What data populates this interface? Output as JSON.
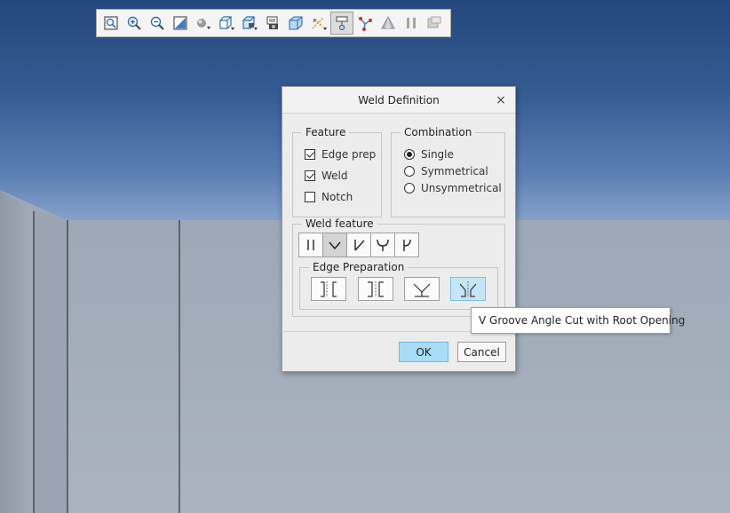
{
  "toolbar": {
    "buttons": [
      {
        "icon": "refit-icon"
      },
      {
        "icon": "zoom-in-icon"
      },
      {
        "icon": "zoom-out-icon"
      },
      {
        "icon": "repaint-icon"
      },
      {
        "icon": "display-style-icon"
      },
      {
        "icon": "saved-orientations-icon"
      },
      {
        "icon": "view-manager-icon"
      },
      {
        "icon": "perspective-icon"
      },
      {
        "icon": "named-views-icon"
      },
      {
        "icon": "datum-display-icon"
      },
      {
        "icon": "annotation-display-icon",
        "active": true
      },
      {
        "icon": "spin-center-icon"
      },
      {
        "icon": "appearance-icon"
      },
      {
        "icon": "pause-icon"
      },
      {
        "icon": "hide-icon"
      }
    ]
  },
  "dialog": {
    "title": "Weld Definition",
    "close_glyph": "×",
    "feature": {
      "label": "Feature",
      "options": [
        {
          "label": "Edge prep",
          "checked": true
        },
        {
          "label": "Weld",
          "checked": true
        },
        {
          "label": "Notch",
          "checked": false
        }
      ]
    },
    "combination": {
      "label": "Combination",
      "options": [
        {
          "label": "Single",
          "checked": true
        },
        {
          "label": "Symmetrical",
          "checked": false
        },
        {
          "label": "Unsymmetrical",
          "checked": false
        }
      ]
    },
    "weld_feature": {
      "label": "Weld feature",
      "buttons": [
        {
          "icon": "square-groove-icon"
        },
        {
          "icon": "v-groove-icon",
          "selected": true
        },
        {
          "icon": "bevel-groove-icon"
        },
        {
          "icon": "u-groove-icon"
        },
        {
          "icon": "j-groove-icon"
        }
      ]
    },
    "edge_preparation": {
      "label": "Edge Preparation",
      "buttons": [
        {
          "icon": "square-cut-icon"
        },
        {
          "icon": "square-cut-root-opening-icon"
        },
        {
          "icon": "v-groove-angle-cut-icon"
        },
        {
          "icon": "v-groove-angle-cut-root-opening-icon",
          "selected": true
        }
      ]
    },
    "ok_label": "OK",
    "cancel_label": "Cancel"
  },
  "tooltip": {
    "text": "V Groove Angle Cut with Root Opening"
  },
  "colors": {
    "accent": "#a9ddf7",
    "selected_edge_prep": "#c5e6f8",
    "viewport_top": "#24477c",
    "model_surface": "#a2adba"
  }
}
